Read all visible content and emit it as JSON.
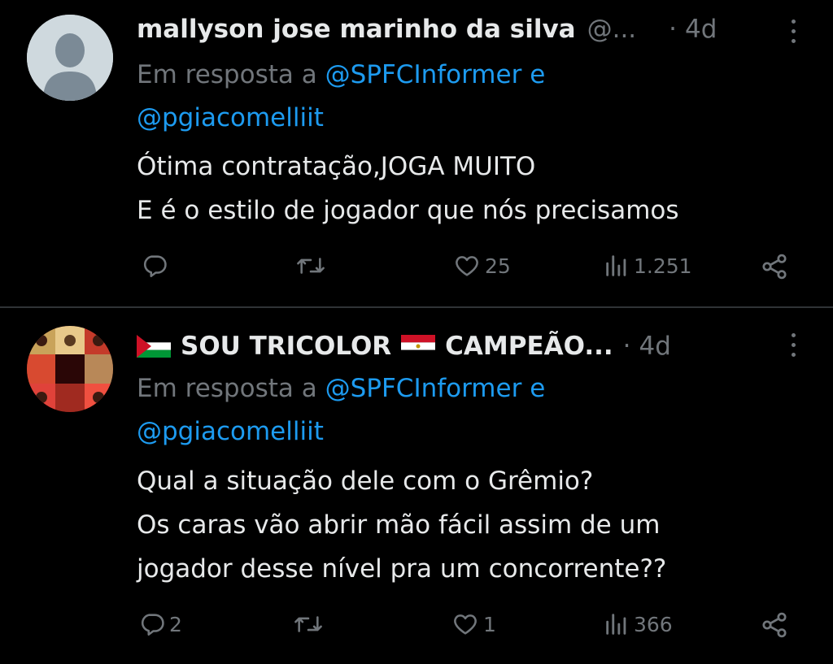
{
  "tweets": [
    {
      "name": "mallyson jose marinho da silva",
      "handle": "@...",
      "time": "4d",
      "reply_prefix": "Em resposta a",
      "mention1": "@SPFCInformer",
      "conj": "e",
      "mention2": "@pgiacomelliit",
      "body_lines": [
        "Ótima contratação,JOGA MUITO",
        "E é o estilo de jogador que nós precisamos"
      ],
      "reply_count": "",
      "retweet_count": "",
      "like_count": "25",
      "view_count": "1.251"
    },
    {
      "name": "SOU TRICOLOR",
      "name_suffix": "CAMPEÃO...",
      "time": "4d",
      "reply_prefix": "Em resposta a",
      "mention1": "@SPFCInformer",
      "conj": "e",
      "mention2": "@pgiacomelliit",
      "body_lines": [
        "Qual a situação dele com o Grêmio?",
        "Os caras vão abrir mão fácil assim de um",
        "jogador desse nível pra um concorrente??"
      ],
      "reply_count": "2",
      "retweet_count": "",
      "like_count": "1",
      "view_count": "366"
    }
  ],
  "icons": {
    "avatar_default": "default-avatar-icon",
    "reply": "reply-icon",
    "retweet": "retweet-icon",
    "like": "heart-icon",
    "views": "views-icon",
    "share": "share-icon",
    "more": "more-icon",
    "flag1": "palestine-flag-icon",
    "flag2": "egypt-flag-icon"
  },
  "colors": {
    "background": "#000000",
    "text": "#e7e9ea",
    "muted": "#71767b",
    "link": "#1d9bf0",
    "divider": "#2f3336"
  }
}
